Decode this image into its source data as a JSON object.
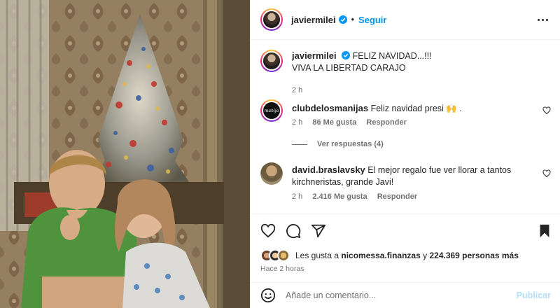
{
  "post": {
    "username": "javiermilei",
    "follow_label": "Seguir",
    "separator": "•",
    "caption_line1": "FELIZ NAVIDAD...!!!",
    "caption_line2": "VIVA LA LIBERTAD CARAJO",
    "caption_time": "2 h"
  },
  "comments": [
    {
      "username": "clubdelosmanijas",
      "text": "Feliz navidad presi 🙌 .",
      "time": "2 h",
      "likes": "86 Me gusta",
      "reply_label": "Responder",
      "avatar_text": "manija"
    },
    {
      "username": "david.braslavsky",
      "text": "El mejor regalo fue ver llorar a tantos kirchneristas, grande Javi!",
      "time": "2 h",
      "likes": "2.416 Me gusta",
      "reply_label": "Responder"
    }
  ],
  "view_replies": "Ver respuestas (4)",
  "likes_line": {
    "prefix": "Les gusta a",
    "user": "nicomessa.finanzas",
    "middle": "y",
    "count": "224.369 personas más"
  },
  "posted_ago": "Hace 2 horas",
  "add_comment": {
    "placeholder": "Añade un comentario...",
    "publish_label": "Publicar"
  },
  "icons": {
    "verified": "verified-badge-icon",
    "more": "more-options-icon",
    "like": "heart-icon",
    "comment": "comment-icon",
    "share": "share-icon",
    "save": "bookmark-icon",
    "emoji": "emoji-icon"
  },
  "colors": {
    "link": "#0095f6",
    "muted": "#737373",
    "text": "#262626",
    "publish_disabled": "#b2dffc"
  }
}
